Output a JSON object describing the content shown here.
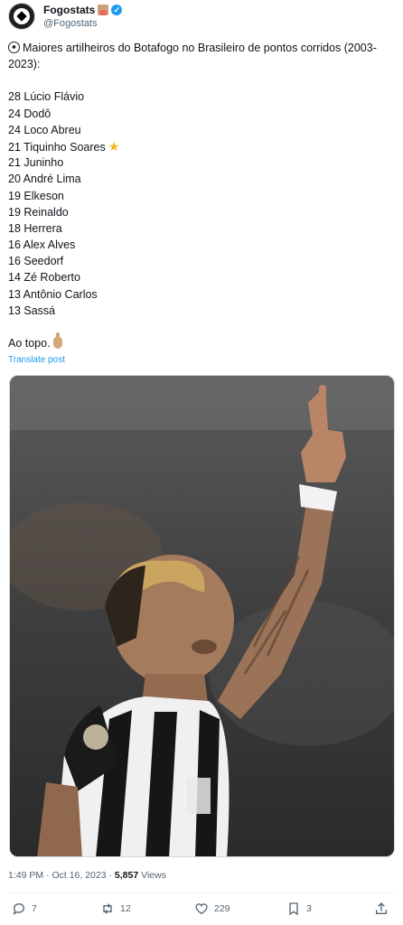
{
  "author": {
    "display_name": "Fogostats",
    "handle": "@Fogostats"
  },
  "tweet": {
    "intro": "Maiores artilheiros do Botafogo no Brasileiro de pontos corridos (2003-2023):",
    "list": [
      "28 Lúcio Flávio",
      "24 Dodô",
      "24 Loco Abreu",
      "21 Tiquinho Soares",
      "21 Juninho",
      "20 André Lima",
      "19 Elkeson",
      "19 Reinaldo",
      "18 Herrera",
      "16 Alex Alves",
      "16 Seedorf",
      "14 Zé Roberto",
      "13 Antônio Carlos",
      "13 Sassá"
    ],
    "outro": "Ao topo.",
    "translate_label": "Translate post"
  },
  "meta": {
    "time": "1:49 PM",
    "separator": "·",
    "date": "Oct 16, 2023",
    "views_count": "5,857",
    "views_label": "Views"
  },
  "actions": {
    "replies": "7",
    "reposts": "12",
    "likes": "229",
    "bookmarks": "3"
  },
  "colors": {
    "accent": "#1d9bf0",
    "muted": "#536471"
  }
}
